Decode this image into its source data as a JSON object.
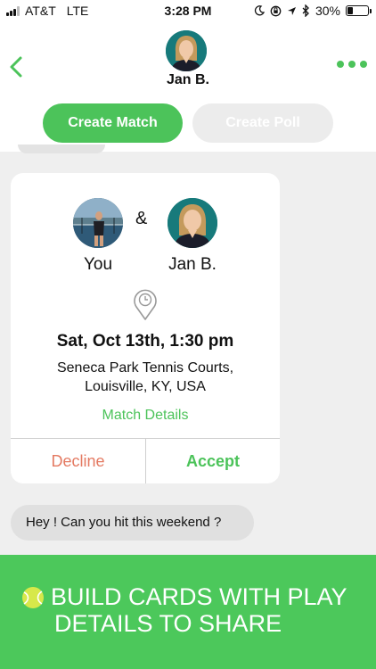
{
  "status_bar": {
    "carrier": "AT&T",
    "network": "LTE",
    "time": "3:28 PM",
    "battery_percent": "30%",
    "battery_level": 0.3,
    "icons": [
      "moon-icon",
      "orientation-lock-icon",
      "location-icon",
      "bluetooth-icon",
      "battery-icon"
    ]
  },
  "header": {
    "contact_name": "Jan B.",
    "create_match_label": "Create Match",
    "create_poll_label": "Create Poll",
    "icons": [
      "back-chevron-icon",
      "more-dots-icon"
    ]
  },
  "match_card": {
    "player_one": "You",
    "separator": "&",
    "player_two": "Jan B.",
    "date_time": "Sat, Oct 13th, 1:30 pm",
    "location_line1": "Seneca Park Tennis Courts,",
    "location_line2": "Louisville, KY, USA",
    "details_link": "Match Details",
    "decline_label": "Decline",
    "accept_label": "Accept",
    "icons": [
      "clock-pin-icon"
    ]
  },
  "message": {
    "text": "Hey ! Can you hit this weekend ?"
  },
  "promo": {
    "line1": "BUILD CARDS WITH PLAY",
    "line2": "DETAILS TO SHARE",
    "icons": [
      "tennis-ball-icon"
    ]
  },
  "colors": {
    "accent": "#4cc35a",
    "decline": "#e47a62",
    "promo_bg": "#4cc85b",
    "background": "#efefef"
  }
}
